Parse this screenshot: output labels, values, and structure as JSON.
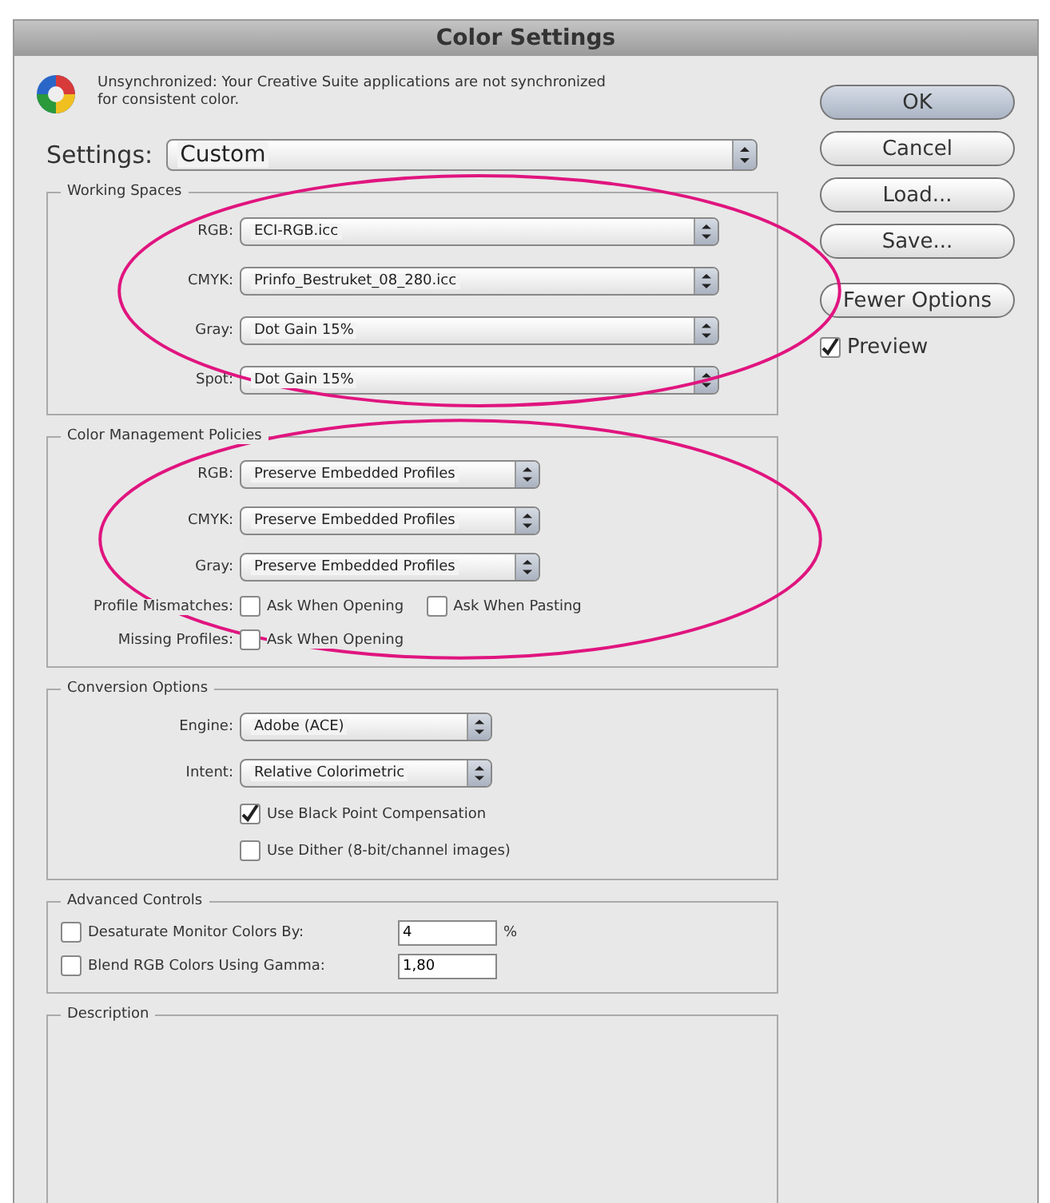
{
  "window": {
    "title": "Color Settings"
  },
  "sync_message": "Unsynchronized: Your Creative Suite applications are not synchronized for consistent color.",
  "settings": {
    "label": "Settings:",
    "value": "Custom"
  },
  "working_spaces": {
    "title": "Working Spaces",
    "highlighted": true,
    "rows": [
      {
        "label": "RGB:",
        "value": "ECI-RGB.icc"
      },
      {
        "label": "CMYK:",
        "value": "Prinfo_Bestruket_08_280.icc"
      },
      {
        "label": "Gray:",
        "value": "Dot Gain 15%"
      },
      {
        "label": "Spot:",
        "value": "Dot Gain 15%"
      }
    ]
  },
  "color_management_policies": {
    "title": "Color Management Policies",
    "highlighted": true,
    "rows": [
      {
        "label": "RGB:",
        "value": "Preserve Embedded Profiles"
      },
      {
        "label": "CMYK:",
        "value": "Preserve Embedded Profiles"
      },
      {
        "label": "Gray:",
        "value": "Preserve Embedded Profiles"
      }
    ],
    "checks": [
      {
        "label": "Profile Mismatches:",
        "options": [
          {
            "label": "Ask When Opening",
            "checked": false
          },
          {
            "label": "Ask When Pasting",
            "checked": false
          }
        ]
      },
      {
        "label": "Missing Profiles:",
        "options": [
          {
            "label": "Ask When Opening",
            "checked": false
          }
        ]
      }
    ]
  },
  "conversion_options": {
    "title": "Conversion Options",
    "rows": [
      {
        "label": "Engine:",
        "value": "Adobe (ACE)"
      },
      {
        "label": "Intent:",
        "value": "Relative Colorimetric"
      }
    ],
    "options": [
      {
        "label": "Use Black Point Compensation",
        "checked": true
      },
      {
        "label": "Use Dither (8-bit/channel images)",
        "checked": false
      }
    ]
  },
  "advanced_controls": {
    "title": "Advanced Controls",
    "rows": [
      {
        "label": "Desaturate Monitor Colors By:",
        "checked": false,
        "value": "4",
        "unit": "%"
      },
      {
        "label": "Blend RGB Colors Using Gamma:",
        "checked": false,
        "value": "1,80"
      }
    ]
  },
  "description": {
    "title": "Description"
  },
  "buttons": [
    {
      "label": "OK",
      "default": true
    },
    {
      "label": "Cancel",
      "default": false
    },
    {
      "label": "Load...",
      "default": false
    },
    {
      "label": "Save...",
      "default": false
    }
  ],
  "more_button": {
    "label": "Fewer Options"
  },
  "preview": {
    "label": "Preview",
    "checked": true
  }
}
